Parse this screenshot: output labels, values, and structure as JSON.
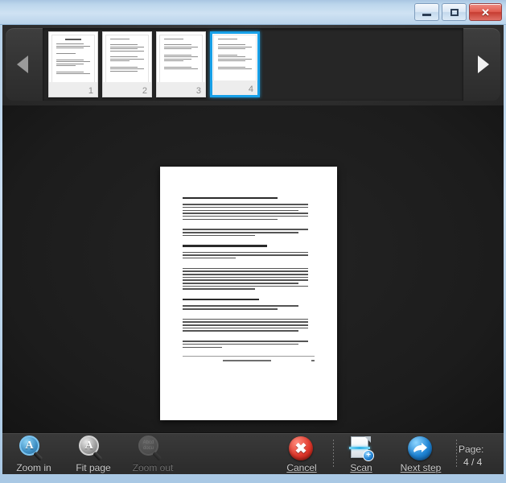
{
  "window": {
    "title": "",
    "controls": [
      {
        "name": "minimize",
        "label": "Minimize",
        "glyph": "minimize-icon"
      },
      {
        "name": "maximize",
        "label": "Maximize",
        "glyph": "maximize-icon"
      },
      {
        "name": "close",
        "label": "Close",
        "glyph": "close-icon"
      }
    ],
    "close_glyph": "✕"
  },
  "filmstrip": {
    "prev_label": "Previous pages",
    "next_label": "Next pages",
    "prev_icon": "chevron-left-icon",
    "next_icon": "chevron-right-icon",
    "selected_index": 4,
    "thumbnails": [
      {
        "number": "1",
        "selected": false
      },
      {
        "number": "2",
        "selected": false
      },
      {
        "number": "3",
        "selected": false
      },
      {
        "number": "4",
        "selected": true
      }
    ]
  },
  "preview": {
    "current_page": "4",
    "page_aspect": "portrait"
  },
  "toolbar": {
    "zoom_in": {
      "label": "Zoom in",
      "icon": "magnifier-plus-icon",
      "enabled": true,
      "accesskey": "i"
    },
    "fit_page": {
      "label": "Fit page",
      "icon": "magnifier-fit-icon",
      "enabled": true,
      "accesskey": "F"
    },
    "zoom_out": {
      "label": "Zoom out",
      "icon": "magnifier-minus-icon",
      "enabled": false,
      "accesskey": "o"
    },
    "zoom_out_icon_text": "Abcd docu",
    "cancel": {
      "label": "Cancel",
      "icon": "cancel-icon",
      "enabled": true,
      "accesskey": "C"
    },
    "scan": {
      "label": "Scan",
      "icon": "scanner-icon",
      "enabled": true,
      "accesskey": "S"
    },
    "next_step": {
      "label": "Next step",
      "icon": "arrow-right-icon",
      "enabled": true,
      "accesskey": "N"
    },
    "page_label": "Page:",
    "page_value": "4 / 4"
  },
  "colors": {
    "accent_blue": "#18a0e8",
    "cancel_red": "#e0382c",
    "chrome_dark": "#2b2b2b",
    "preview_bg": "#1e1e1e",
    "titlebar_blue": "#cfe2f3"
  }
}
